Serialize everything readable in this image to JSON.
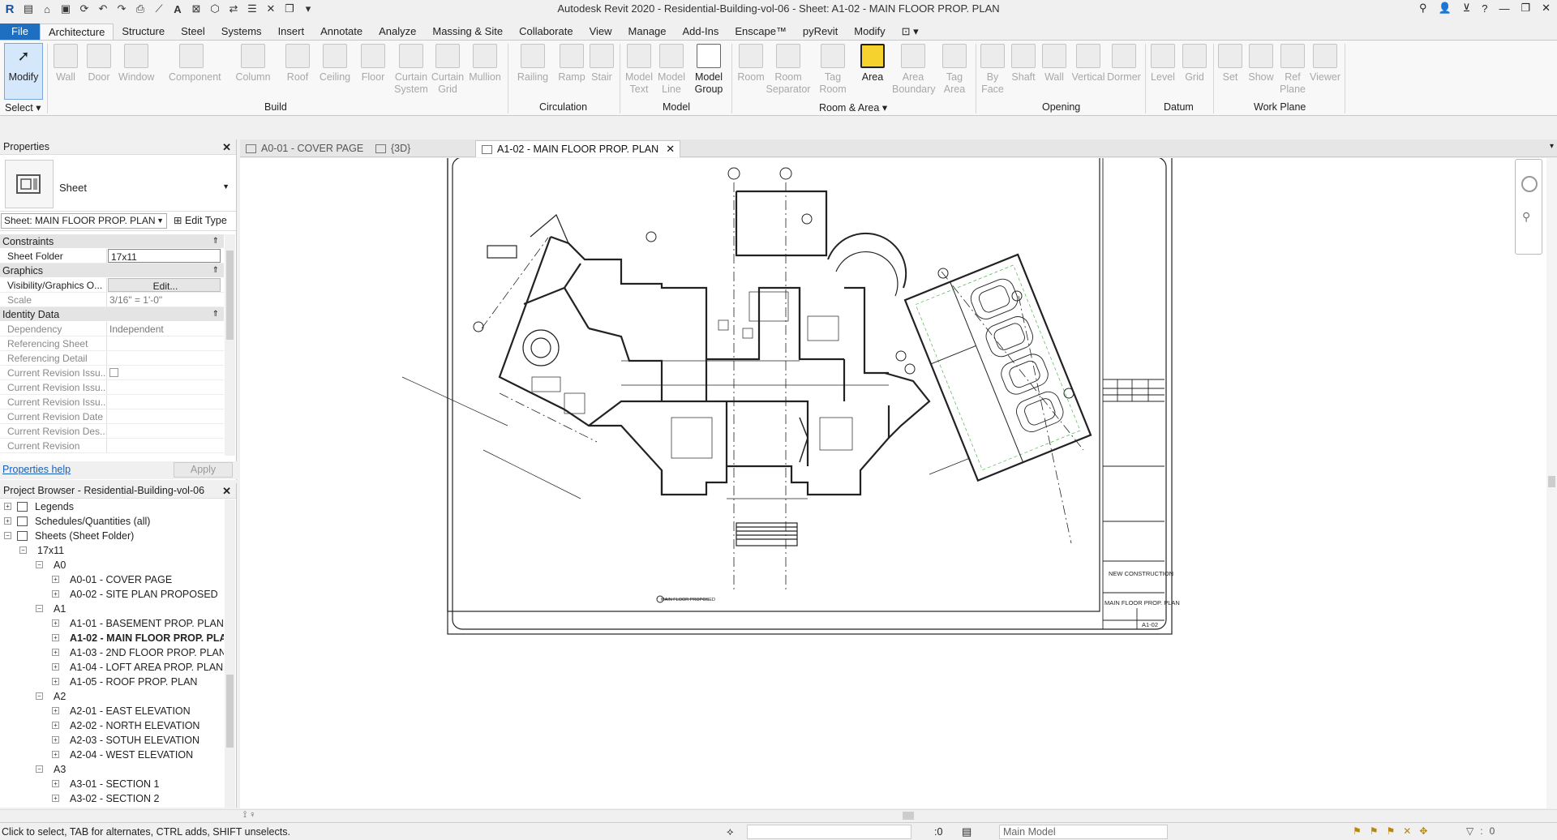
{
  "window": {
    "title": "Autodesk Revit 2020 - Residential-Building-vol-06 - Sheet: A1-02 - MAIN FLOOR PROP. PLAN"
  },
  "ribbon": {
    "tabs": [
      "File",
      "Architecture",
      "Structure",
      "Steel",
      "Systems",
      "Insert",
      "Annotate",
      "Analyze",
      "Massing & Site",
      "Collaborate",
      "View",
      "Manage",
      "Add-Ins",
      "Enscape™",
      "pyRevit",
      "Modify"
    ],
    "active_tab": "Architecture",
    "tools": {
      "modify": "Modify",
      "wall": "Wall",
      "door": "Door",
      "window": "Window",
      "component": "Component",
      "column": "Column",
      "roof": "Roof",
      "ceiling": "Ceiling",
      "floor": "Floor",
      "curtain_system": "Curtain System",
      "curtain_grid": "Curtain Grid",
      "mullion": "Mullion",
      "railing": "Railing",
      "ramp": "Ramp",
      "stair": "Stair",
      "model_text": "Model Text",
      "model_line": "Model Line",
      "model_group": "Model Group",
      "room": "Room",
      "room_separator": "Room Separator",
      "tag_room": "Tag Room",
      "area": "Area",
      "area_boundary": "Area Boundary",
      "tag_area": "Tag Area",
      "by_face": "By Face",
      "shaft": "Shaft",
      "op_wall": "Wall",
      "vertical": "Vertical",
      "dormer": "Dormer",
      "level": "Level",
      "grid": "Grid",
      "set": "Set",
      "show": "Show",
      "ref_plane": "Ref Plane",
      "viewer": "Viewer"
    },
    "groups": {
      "select": "Select",
      "build": "Build",
      "circulation": "Circulation",
      "model": "Model",
      "room_area": "Room & Area",
      "opening": "Opening",
      "datum": "Datum",
      "work_plane": "Work Plane"
    }
  },
  "properties": {
    "title": "Properties",
    "type_name": "Sheet",
    "instance_selector": "Sheet: MAIN FLOOR PROP. PLAN",
    "edit_type": "Edit Type",
    "categories": {
      "constraints": "Constraints",
      "graphics": "Graphics",
      "identity": "Identity Data"
    },
    "rows": {
      "sheet_folder": {
        "key": "Sheet Folder",
        "value": "17x11"
      },
      "vis_graphics": {
        "key": "Visibility/Graphics O...",
        "value": "Edit..."
      },
      "scale": {
        "key": "Scale",
        "value": "3/16\" = 1'-0\""
      },
      "dependency": {
        "key": "Dependency",
        "value": "Independent"
      },
      "ref_sheet": {
        "key": "Referencing Sheet",
        "value": ""
      },
      "ref_detail": {
        "key": "Referencing Detail",
        "value": ""
      },
      "cur_rev_issued": {
        "key": "Current Revision Issu...",
        "value": ""
      },
      "cur_rev_issued_by": {
        "key": "Current Revision Issu...",
        "value": ""
      },
      "cur_rev_issued_to": {
        "key": "Current Revision Issu...",
        "value": ""
      },
      "cur_rev_date": {
        "key": "Current Revision Date",
        "value": ""
      },
      "cur_rev_desc": {
        "key": "Current Revision Des...",
        "value": ""
      },
      "cur_rev": {
        "key": "Current Revision",
        "value": ""
      }
    },
    "help": "Properties help",
    "apply": "Apply"
  },
  "browser": {
    "title": "Project Browser - Residential-Building-vol-06",
    "nodes": {
      "legends": "Legends",
      "schedules": "Schedules/Quantities (all)",
      "sheets": "Sheets (Sheet Folder)",
      "f17x11": "17x11",
      "a0": "A0",
      "a001": "A0-01 - COVER PAGE",
      "a002": "A0-02 - SITE PLAN PROPOSED",
      "a1": "A1",
      "a101": "A1-01 - BASEMENT PROP. PLAN",
      "a102": "A1-02 - MAIN FLOOR PROP. PLAN",
      "a103": "A1-03 - 2ND FLOOR PROP. PLAN",
      "a104": "A1-04 - LOFT AREA PROP. PLAN",
      "a105": "A1-05 - ROOF PROP. PLAN",
      "a2": "A2",
      "a201": "A2-01 - EAST ELEVATION",
      "a202": "A2-02 - NORTH ELEVATION",
      "a203": "A2-03 - SOTUH ELEVATION",
      "a204": "A2-04 - WEST ELEVATION",
      "a3": "A3",
      "a301": "A3-01 - SECTION 1",
      "a302": "A3-02 - SECTION 2"
    }
  },
  "view_tabs": [
    "A0-01 - COVER PAGE",
    "{3D}",
    "A1-02 - MAIN FLOOR PROP. PLAN"
  ],
  "sheet": {
    "project_name": "NEW CONSTRUCTION",
    "sheet_name": "MAIN FLOOR PROP. PLAN",
    "sheet_number": "A1-02",
    "view_title": "MAIN FLOOR PROPOSED"
  },
  "status": {
    "message": "Click to select, TAB for alternates, CTRL adds, SHIFT unselects.",
    "selection_count": ":0",
    "model": "Main Model"
  },
  "colors": {
    "file_tab": "#1e6fc1",
    "area_tool": "#f5d22e",
    "link": "#1a5fb4"
  }
}
